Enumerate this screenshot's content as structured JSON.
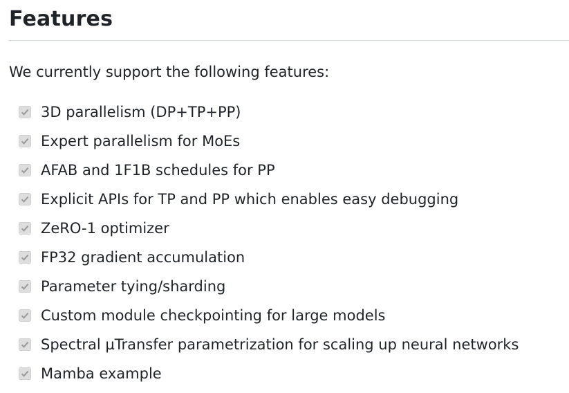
{
  "heading": "Features",
  "intro": "We currently support the following features:",
  "features": [
    {
      "label": "3D parallelism (DP+TP+PP)",
      "checked": true
    },
    {
      "label": "Expert parallelism for MoEs",
      "checked": true
    },
    {
      "label": "AFAB and 1F1B schedules for PP",
      "checked": true
    },
    {
      "label": "Explicit APIs for TP and PP which enables easy debugging",
      "checked": true
    },
    {
      "label": "ZeRO-1 optimizer",
      "checked": true
    },
    {
      "label": "FP32 gradient accumulation",
      "checked": true
    },
    {
      "label": "Parameter tying/sharding",
      "checked": true
    },
    {
      "label": "Custom module checkpointing for large models",
      "checked": true
    },
    {
      "label": "Spectral µTransfer parametrization for scaling up neural networks",
      "checked": true
    },
    {
      "label": "Mamba example",
      "checked": true
    }
  ],
  "icons": {
    "checkbox": "checkbox-checked-icon"
  },
  "colors": {
    "text": "#1f2328",
    "rule": "#d8dee4",
    "checkbox_fill": "#dedede",
    "checkmark": "#9a9a9a"
  }
}
